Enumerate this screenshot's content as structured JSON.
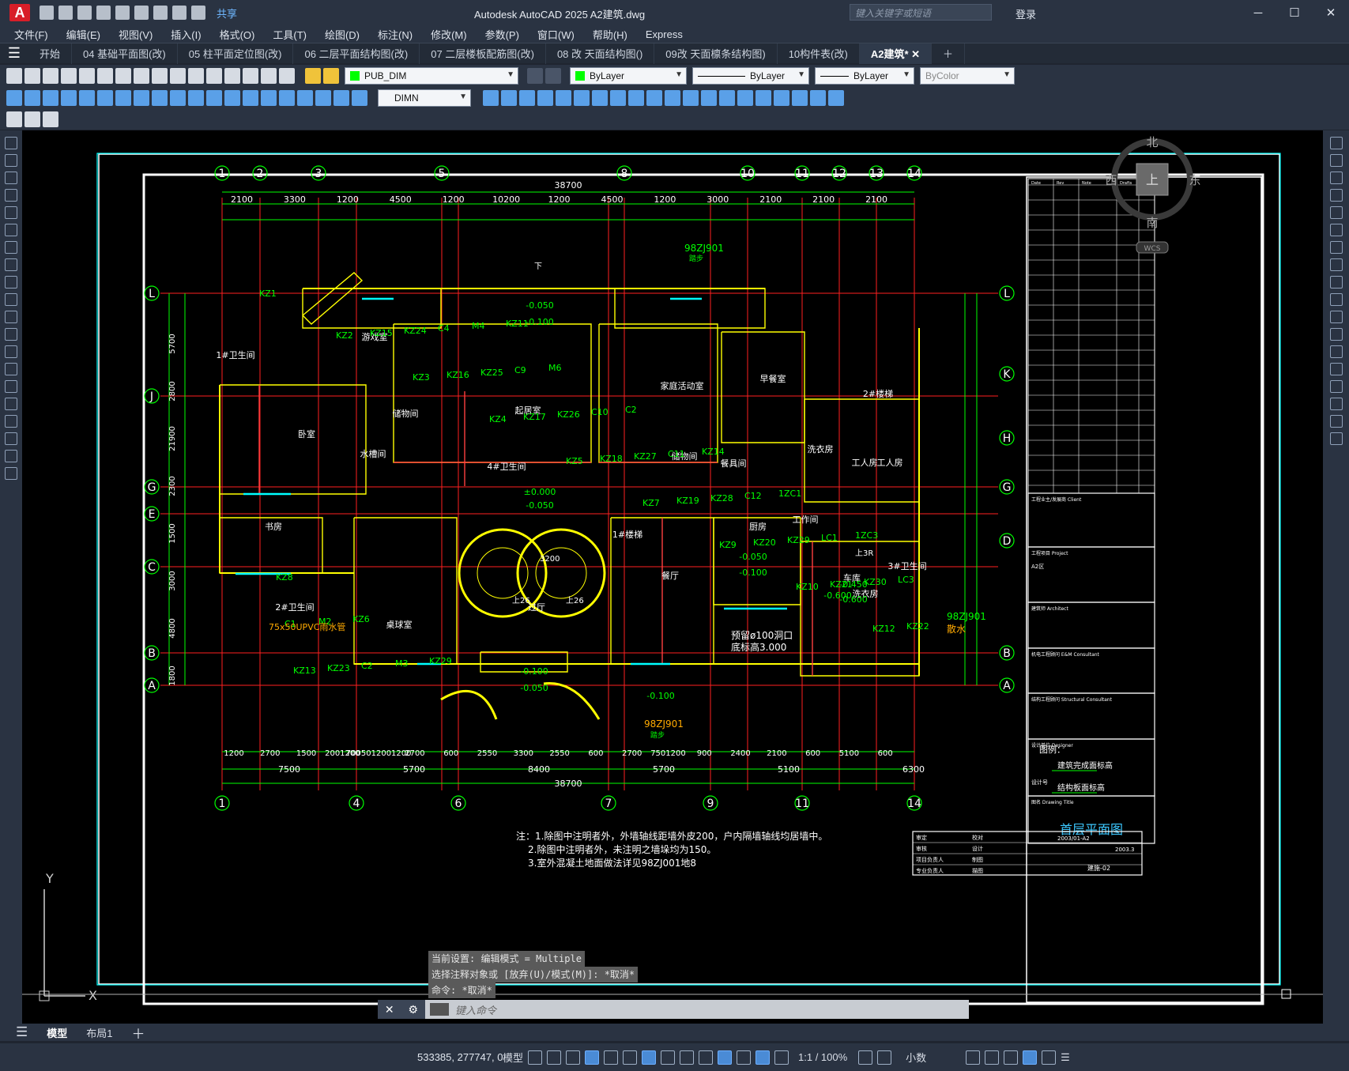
{
  "app": {
    "logo": "A",
    "title": "Autodesk AutoCAD 2025    A2建筑.dwg",
    "share_label": "共享",
    "search_placeholder": "键入关键字或短语",
    "login_label": "登录"
  },
  "menu": [
    "文件(F)",
    "编辑(E)",
    "视图(V)",
    "插入(I)",
    "格式(O)",
    "工具(T)",
    "绘图(D)",
    "标注(N)",
    "修改(M)",
    "参数(P)",
    "窗口(W)",
    "帮助(H)",
    "Express"
  ],
  "tabs": [
    {
      "label": "开始",
      "active": false
    },
    {
      "label": "04 基础平面图(改)",
      "active": false
    },
    {
      "label": "05 柱平面定位图(改)",
      "active": false
    },
    {
      "label": "06 二层平面结构图(改)",
      "active": false
    },
    {
      "label": "07 二层楼板配筋图(改)",
      "active": false
    },
    {
      "label": "08 改 天面结构图()",
      "active": false
    },
    {
      "label": "09改 天面檩条结构图)",
      "active": false
    },
    {
      "label": "10构件表(改)",
      "active": false
    },
    {
      "label": "A2建筑*",
      "active": true
    }
  ],
  "toolbar": {
    "layer": "PUB_DIM",
    "color": "ByLayer",
    "linetype": "ByLayer",
    "lineweight": "ByLayer",
    "plotstyle": "ByColor",
    "dimstyle": "DIMN"
  },
  "drawing": {
    "total_dim": "38700",
    "top_axes": [
      "1",
      "2",
      "3",
      "5",
      "8",
      "10",
      "11",
      "12",
      "13",
      "14"
    ],
    "bottom_axes": [
      "1",
      "4",
      "6",
      "7",
      "9",
      "11",
      "14"
    ],
    "left_axes": [
      "L",
      "J",
      "G",
      "E",
      "C",
      "B",
      "A"
    ],
    "right_axes": [
      "L",
      "K",
      "H",
      "G",
      "D",
      "B",
      "A"
    ],
    "top_dims_1": [
      "2100",
      "3300",
      "1200",
      "4500",
      "1200",
      "10200",
      "1200",
      "4500",
      "1200",
      "3000",
      "2100",
      "2100",
      "2100"
    ],
    "bottom_dims_1": [
      "1200",
      "2700",
      "1500",
      "2001200",
      "7005012001200",
      "2700",
      "600",
      "2550",
      "3300",
      "2550",
      "600",
      "2700",
      "7501200",
      "900",
      "2400",
      "2100",
      "600",
      "5100",
      "600"
    ],
    "bottom_dims_2": [
      "7500",
      "5700",
      "8400",
      "5700",
      "5100",
      "6300"
    ],
    "left_dims": [
      "5700",
      "2800",
      "21900",
      "2300",
      "1500",
      "3000",
      "4800",
      "1800"
    ],
    "rooms": [
      {
        "name": "游戏室"
      },
      {
        "name": "起居室"
      },
      {
        "name": "家庭活动室"
      },
      {
        "name": "1#卫生间"
      },
      {
        "name": "储物间"
      },
      {
        "name": "卧室"
      },
      {
        "name": "水槽间"
      },
      {
        "name": "4#卫生间"
      },
      {
        "name": "储物间"
      },
      {
        "name": "餐具间"
      },
      {
        "name": "早餐室"
      },
      {
        "name": "2#楼梯"
      },
      {
        "name": "洗衣房"
      },
      {
        "name": "工人房"
      },
      {
        "name": "工人房"
      },
      {
        "name": "书房"
      },
      {
        "name": "1#楼梯"
      },
      {
        "name": "餐厅"
      },
      {
        "name": "厨房"
      },
      {
        "name": "工作间"
      },
      {
        "name": "车库"
      },
      {
        "name": "3#卫生间"
      },
      {
        "name": "2#卫生间"
      },
      {
        "name": "桌球室"
      },
      {
        "name": "过厅"
      },
      {
        "name": "洗衣房"
      }
    ],
    "levels": [
      "-0.050",
      "-0.100",
      "±0.000",
      "-0.050",
      "-0.100",
      "-0.050",
      "-0.100",
      "-0.600",
      "-0.450",
      "-0.600",
      "-0.050",
      "-0.100"
    ],
    "tags": [
      "KZ1",
      "KZ2",
      "KZ3",
      "KZ4",
      "KZ5",
      "KZ7",
      "KZ9",
      "KZ10",
      "KZ12",
      "KZ13",
      "KZ15",
      "KZ16",
      "KZ17",
      "KZ18",
      "KZ19",
      "KZ20",
      "KZ21",
      "KZ22",
      "KZ23",
      "KZ24",
      "KZ25",
      "KZ26",
      "KZ27",
      "KZ28",
      "KZ29",
      "KZ30",
      "C1",
      "C2",
      "C4",
      "C9",
      "C10",
      "C11",
      "C12",
      "LC1",
      "LC3",
      "M2",
      "M3",
      "M4",
      "M6",
      "C2",
      "KZ14",
      "1ZC1",
      "1ZC3",
      "KZ8",
      "KZ6",
      "KZ29",
      "KZ11"
    ],
    "notes": [
      "注：1.除图中注明者外，外墙轴线距墙外皮200，户内隔墙轴线均居墙中。",
      "2.除图中注明者外，未注明之墙垛均为150。",
      "3.室外混凝土地面做法详见98ZJ001地8"
    ],
    "std_refs": [
      "98ZJ901",
      "踏步",
      "98ZJ901",
      "98ZJ901",
      "踏步",
      "散水"
    ],
    "pipe_label": "75x50UPVC雨水管",
    "stair_labels": [
      "上26",
      "上26",
      "下",
      "3200",
      "上3R"
    ],
    "drain_label": "预留ø100洞口",
    "drain_elev": "底标高3.000",
    "legend_title": "图例：",
    "legend_items": [
      "建筑完成面标高",
      "结构板面标高"
    ],
    "title_block": {
      "header_cols": [
        "Date",
        "Rev",
        "Note",
        "Drafts",
        "Checked"
      ],
      "client_label": "工程业主/发展商 Client",
      "project_label": "工程项目 Project",
      "project_value": "A2区",
      "architect_label": "建筑师 Architect",
      "ee_label": "机电工程顾问 E&M Consultant",
      "struct_label": "结构工程顾问 Structural Consultant",
      "designer_label": "设计单位 Designer",
      "checked_label": "设计号",
      "dwg_title_label": "图名 Drawing Title",
      "dwg_title": "首层平面图",
      "rows": [
        [
          "审定",
          "",
          "校对",
          ""
        ],
        [
          "审核",
          "",
          "设计",
          ""
        ],
        [
          "项目负责人",
          "",
          "制图",
          ""
        ],
        [
          "专业负责人",
          "",
          "描图",
          ""
        ]
      ],
      "date_no": "2003/01-A2",
      "year": "2003.3",
      "sheet": "建施-02"
    },
    "compass": {
      "n": "北",
      "s": "南",
      "e": "东",
      "w": "西",
      "center": "上",
      "wcs": "WCS"
    },
    "ucs_y": "Y",
    "ucs_x": "X"
  },
  "command": {
    "history": [
      "当前设置: 编辑模式 = Multiple",
      "选择注释对象或 [放弃(U)/模式(M)]: *取消*",
      "命令: *取消*"
    ],
    "placeholder": "键入命令"
  },
  "layout_tabs": [
    "模型",
    "布局1"
  ],
  "status": {
    "coords": "533385, 277747, 0",
    "space": "模型",
    "scale": "1:1 / 100%",
    "units": "小数"
  },
  "colors": {
    "grid_axis": "#ff2020",
    "dim": "#00ff00",
    "wall": "#ffff00",
    "frame": "#00ffff",
    "text": "#ffffff",
    "sheet_border": "#ffffff"
  }
}
